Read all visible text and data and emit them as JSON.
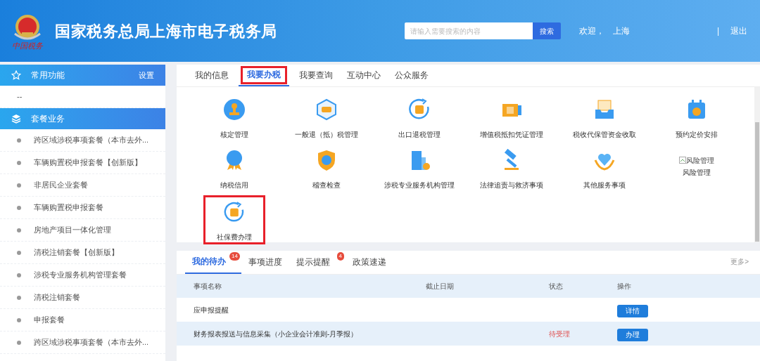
{
  "header": {
    "title": "国家税务总局上海市电子税务局",
    "emblem_caption": "中国税务",
    "search": {
      "placeholder": "请输入需要搜索的内容",
      "button": "搜索"
    },
    "welcome": "欢迎，",
    "user": "上海",
    "separator": "|",
    "logout": "退出"
  },
  "sidebar": {
    "sections": [
      {
        "kind": "star",
        "title": "常用功能",
        "action": "设置",
        "items": [
          {
            "kind": "plain",
            "label": "--"
          }
        ]
      },
      {
        "kind": "layers",
        "title": "套餐业务",
        "items": [
          {
            "kind": "bullet",
            "label": "跨区域涉税事项套餐（本市去外..."
          },
          {
            "kind": "bullet",
            "label": "车辆购置税申报套餐【创新版】"
          },
          {
            "kind": "bullet",
            "label": "非居民企业套餐"
          },
          {
            "kind": "bullet",
            "label": "车辆购置税申报套餐"
          },
          {
            "kind": "bullet",
            "label": "房地产项目一体化管理"
          },
          {
            "kind": "bullet",
            "label": "清税注销套餐【创新版】"
          },
          {
            "kind": "bullet",
            "label": "涉税专业服务机构管理套餐"
          },
          {
            "kind": "bullet",
            "label": "清税注销套餐"
          },
          {
            "kind": "bullet",
            "label": "申报套餐"
          },
          {
            "kind": "bullet",
            "label": "跨区域涉税事项套餐（本市去外..."
          }
        ]
      }
    ]
  },
  "main_tabs": [
    {
      "label": "我的信息",
      "selected": false,
      "highlighted": false
    },
    {
      "label": "我要办税",
      "selected": true,
      "highlighted": true
    },
    {
      "label": "我要查询",
      "selected": false,
      "highlighted": false
    },
    {
      "label": "互动中心",
      "selected": false,
      "highlighted": false
    },
    {
      "label": "公众服务",
      "selected": false,
      "highlighted": false
    }
  ],
  "services": [
    {
      "kind": "stamp",
      "label": "核定管理",
      "highlighted": false
    },
    {
      "kind": "refund",
      "label": "一般退（抵）税管理",
      "highlighted": false
    },
    {
      "kind": "tax-cycle",
      "label": "出口退税管理",
      "highlighted": false
    },
    {
      "kind": "voucher",
      "label": "增值税抵扣凭证管理",
      "highlighted": false
    },
    {
      "kind": "tray",
      "label": "税收代保管资金收取",
      "highlighted": false
    },
    {
      "kind": "calendar",
      "label": "预约定价安排",
      "highlighted": false
    },
    {
      "kind": "medal",
      "label": "纳税信用",
      "highlighted": false
    },
    {
      "kind": "shield",
      "label": "稽查检查",
      "highlighted": false
    },
    {
      "kind": "building",
      "label": "涉税专业服务机构管理",
      "highlighted": false
    },
    {
      "kind": "gavel",
      "label": "法律追责与救济事项",
      "highlighted": false
    },
    {
      "kind": "heart",
      "label": "其他服务事项",
      "highlighted": false
    },
    {
      "kind": "broken",
      "alt": "风险管理",
      "label": "风险管理",
      "highlighted": false
    },
    {
      "kind": "tax-cycle",
      "label": "社保费办理",
      "highlighted": true
    }
  ],
  "todo_tabs": [
    {
      "label": "我的待办",
      "badge": "14",
      "selected": true
    },
    {
      "label": "事项进度",
      "selected": false
    },
    {
      "label": "提示提醒",
      "badge": "4",
      "selected": false
    },
    {
      "label": "政策速递",
      "selected": false
    }
  ],
  "more": "更多>",
  "table": {
    "columns": [
      "事项名称",
      "截止日期",
      "状态",
      "操作"
    ],
    "rows": [
      {
        "name": "应申报提醒",
        "action": "详情",
        "selected": false
      },
      {
        "name": "财务报表报送与信息采集（小企业会计准则-月季报）",
        "status": "待受理",
        "action": "办理",
        "selected": true
      }
    ]
  }
}
